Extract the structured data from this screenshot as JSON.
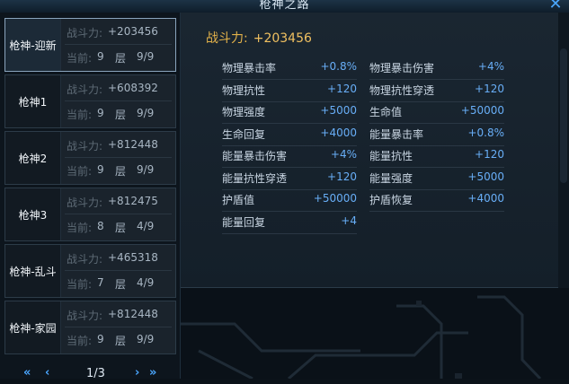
{
  "window": {
    "title": "枪神之路"
  },
  "labels": {
    "power": "战斗力:",
    "current": "当前:",
    "floor": "层"
  },
  "list": [
    {
      "name": "枪神-迎新",
      "power": "+203456",
      "current": "9",
      "progress": "9/9",
      "selected": true
    },
    {
      "name": "枪神1",
      "power": "+608392",
      "current": "9",
      "progress": "9/9"
    },
    {
      "name": "枪神2",
      "power": "+812448",
      "current": "9",
      "progress": "9/9"
    },
    {
      "name": "枪神3",
      "power": "+812475",
      "current": "8",
      "progress": "4/9"
    },
    {
      "name": "枪神-乱斗",
      "power": "+465318",
      "current": "7",
      "progress": "4/9"
    },
    {
      "name": "枪神-家园",
      "power": "+812448",
      "current": "9",
      "progress": "9/9"
    }
  ],
  "pager": {
    "first": "«",
    "prev": "‹",
    "page": "1/3",
    "next": "›",
    "last": "»"
  },
  "detail": {
    "power_label": "战斗力:",
    "power_value": "+203456",
    "stats": [
      {
        "label": "物理暴击率",
        "value": "+0.8%"
      },
      {
        "label": "物理暴击伤害",
        "value": "+4%"
      },
      {
        "label": "物理抗性",
        "value": "+120"
      },
      {
        "label": "物理抗性穿透",
        "value": "+120"
      },
      {
        "label": "物理强度",
        "value": "+5000"
      },
      {
        "label": "生命值",
        "value": "+50000"
      },
      {
        "label": "生命回复",
        "value": "+4000"
      },
      {
        "label": "能量暴击率",
        "value": "+0.8%"
      },
      {
        "label": "能量暴击伤害",
        "value": "+4%"
      },
      {
        "label": "能量抗性",
        "value": "+120"
      },
      {
        "label": "能量抗性穿透",
        "value": "+120"
      },
      {
        "label": "能量强度",
        "value": "+5000"
      },
      {
        "label": "护盾值",
        "value": "+50000"
      },
      {
        "label": "护盾恢复",
        "value": "+4000"
      },
      {
        "label": "能量回复",
        "value": "+4"
      }
    ]
  },
  "colors": {
    "accent": "#4aa6ff",
    "power": "#e3b24a",
    "stat_value": "#68aef7"
  }
}
